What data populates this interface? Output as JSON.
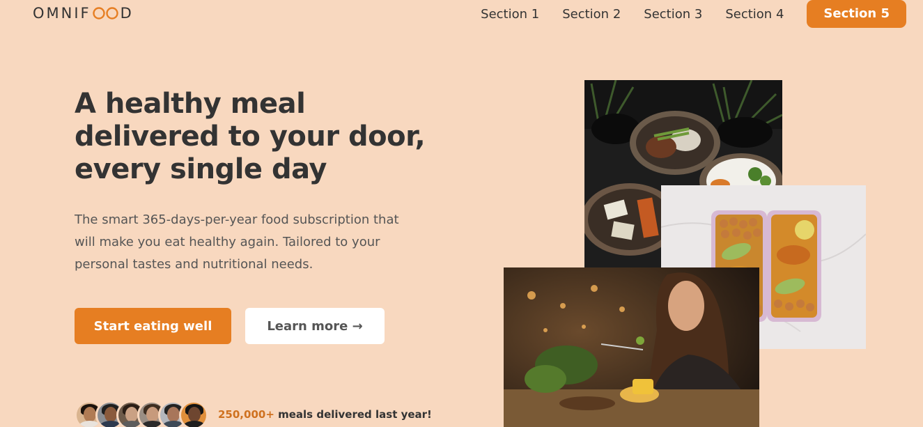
{
  "header": {
    "logo_left": "OMNIF",
    "logo_right": "D",
    "nav": [
      "Section 1",
      "Section 2",
      "Section 3",
      "Section 4"
    ],
    "cta": "Section 5"
  },
  "hero": {
    "title": "A healthy meal delivered to your door, every single day",
    "description": "The smart 365-days-per-year food subscription that will make you eat healthy again. Tailored to your personal tastes and nutritional needs.",
    "primary_button": "Start eating well",
    "secondary_button": "Learn more →"
  },
  "delivered": {
    "count": "250,000+",
    "text": " meals delivered last year!"
  },
  "colors": {
    "background": "#f8d8bf",
    "accent": "#e67e22",
    "text": "#333333"
  }
}
